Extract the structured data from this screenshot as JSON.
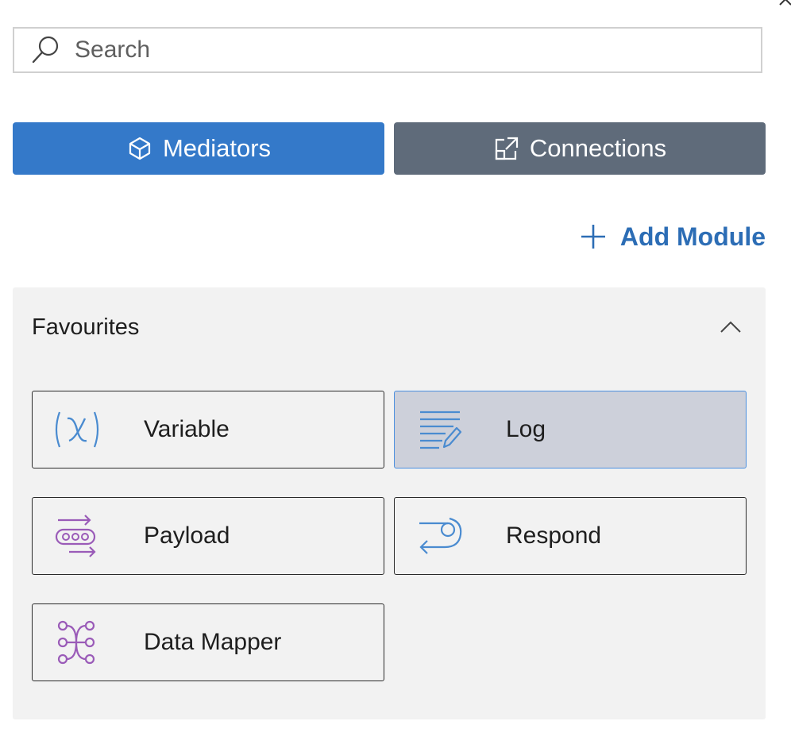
{
  "search": {
    "placeholder": "Search",
    "value": "",
    "icon": "search-icon"
  },
  "tabs": [
    {
      "label": "Mediators",
      "icon": "cube-icon",
      "active": true,
      "color": "#3479c9"
    },
    {
      "label": "Connections",
      "icon": "external-link-icon",
      "active": false,
      "color": "#5f6b7a"
    }
  ],
  "add_module": {
    "label": "Add Module",
    "icon": "plus-icon",
    "color": "#2c6db5"
  },
  "favourites": {
    "title": "Favourites",
    "expanded": true,
    "toggle_icon": "chevron-up-icon",
    "items": [
      {
        "label": "Variable",
        "icon": "variable-icon",
        "selected": false
      },
      {
        "label": "Log",
        "icon": "log-icon",
        "selected": true
      },
      {
        "label": "Payload",
        "icon": "payload-icon",
        "selected": false
      },
      {
        "label": "Respond",
        "icon": "respond-icon",
        "selected": false
      },
      {
        "label": "Data Mapper",
        "icon": "data-mapper-icon",
        "selected": false
      }
    ]
  },
  "colors": {
    "icon_blue": "#4a8bd0",
    "icon_purple": "#9a5bb8",
    "selected_bg": "#cdd0da",
    "selected_border": "#4b8fdf"
  }
}
